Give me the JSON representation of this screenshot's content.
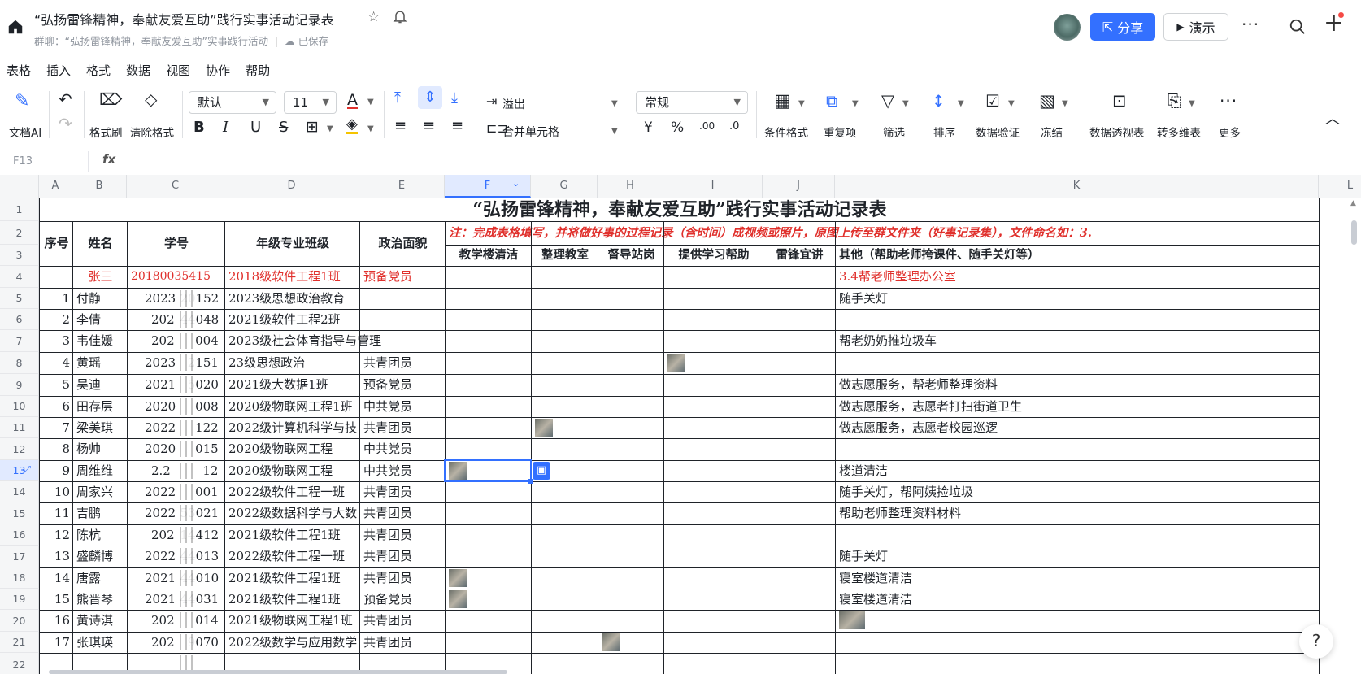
{
  "titlebar": {
    "title": "“弘扬雷锋精神，奉献友爱互助”践行实事活动记录表",
    "subtitle_group": "群聊：“弘扬雷锋精神，奉献友爱互助”实事践行活动",
    "saved_status": "已保存",
    "share_label": "分享",
    "present_label": "演示"
  },
  "menu": [
    "表格",
    "插入",
    "格式",
    "数据",
    "视图",
    "协作",
    "帮助"
  ],
  "toolbar": {
    "doc_ai": "文档AI",
    "format_painter": "格式刷",
    "clear_format": "清除格式",
    "font_name": "默认",
    "font_size": "11",
    "overflow": "溢出",
    "merge_cells": "合并单元格",
    "number_format": "常规",
    "conditional_format": "条件格式",
    "duplicates": "重复项",
    "filter": "筛选",
    "sort": "排序",
    "data_validation": "数据验证",
    "freeze": "冻结",
    "pivot_table": "数据透视表",
    "multi_dim": "转多维表",
    "more": "更多"
  },
  "formula_bar": {
    "cell_ref": "F13",
    "fx": "fx"
  },
  "columns": [
    "A",
    "B",
    "C",
    "D",
    "E",
    "F",
    "G",
    "H",
    "I",
    "J",
    "K",
    "L"
  ],
  "rows": [
    "1",
    "2",
    "3",
    "4",
    "5",
    "6",
    "7",
    "8",
    "9",
    "10",
    "11",
    "12",
    "13",
    "14",
    "15",
    "16",
    "17",
    "18",
    "19",
    "20",
    "21",
    "22"
  ],
  "sheet": {
    "title": "“弘扬雷锋精神，奉献友爱互助”践行实事活动记录表",
    "note": "注：完成表格填写，并将做好事的过程记录（含时间）成视频或照片，原图上传至群文件夹（好事记录集），文件命名如：3.",
    "headers": {
      "seq": "序号",
      "name": "姓名",
      "student_id": "学号",
      "class": "年级专业班级",
      "politics": "政治面貌",
      "f": "教学楼清洁",
      "g": "整理教室",
      "h": "督导站岗",
      "i": "提供学习帮助",
      "j": "雷锋宜讲",
      "k": "其他（帮助老师挎课件、随手关灯等）"
    },
    "example": {
      "name": "张三",
      "student_id": "20180035415",
      "class": "2018级软件工程1班",
      "politics": "预备党员",
      "other": "3.4帮老师整理办公室"
    },
    "records": [
      {
        "seq": "1",
        "name": "付静",
        "id_a": "2023",
        "id_b": "20152",
        "class": "2023级思想政治教育",
        "politics": "",
        "other": "随手关灯"
      },
      {
        "seq": "2",
        "name": "李倩",
        "id_a": "202",
        "id_b": "44048",
        "class": "2021级软件工程2班",
        "politics": "",
        "other": ""
      },
      {
        "seq": "3",
        "name": "韦佳媛",
        "id_a": "202",
        "id_b": "004",
        "class": "2023级社会体育指导与管理",
        "politics": "",
        "other": "帮老奶奶推垃圾车"
      },
      {
        "seq": "4",
        "name": "黄瑶",
        "id_a": "2023",
        "id_b": "2151",
        "class": "23级思想政治",
        "politics": "共青团员",
        "other": ""
      },
      {
        "seq": "5",
        "name": "吴迪",
        "id_a": "2021",
        "id_b": "5020",
        "class": "2021级大数据1班",
        "politics": "预备党员",
        "other": "做志愿服务，帮老师整理资料"
      },
      {
        "seq": "6",
        "name": "田存层",
        "id_a": "2020",
        "id_b": "008",
        "class": "2020级物联网工程1班",
        "politics": "中共党员",
        "other": "做志愿服务，志愿者打扫街道卫生"
      },
      {
        "seq": "7",
        "name": "梁美琪",
        "id_a": "2022",
        "id_b": "122",
        "class": "2022级计算机科学与技",
        "politics": "共青团员",
        "other": "做志愿服务，志愿者校园巡逻"
      },
      {
        "seq": "8",
        "name": "杨帅",
        "id_a": "2020",
        "id_b": "015",
        "class": "2020级物联网工程",
        "politics": "中共党员",
        "other": ""
      },
      {
        "seq": "9",
        "name": "周维维",
        "id_a": "2.2",
        "id_b": "12",
        "class": "2020级物联网工程",
        "politics": "中共党员",
        "other": "楼道清洁"
      },
      {
        "seq": "10",
        "name": "周家兴",
        "id_a": "2022",
        "id_b": "001",
        "class": "2022级软件工程一班",
        "politics": "共青团员",
        "other": "随手关灯，帮阿姨捡垃圾"
      },
      {
        "seq": "11",
        "name": "吉鹏",
        "id_a": "2022",
        "id_b": "53021",
        "class": "2022级数据科学与大数",
        "politics": "共青团员",
        "other": "帮助老师整理资料材料"
      },
      {
        "seq": "12",
        "name": "陈杭",
        "id_a": "202",
        "id_b": "14412",
        "class": "2021级软件工程1班",
        "politics": "共青团员",
        "other": ""
      },
      {
        "seq": "13",
        "name": "盛麟博",
        "id_a": "2022",
        "id_b": "44013",
        "class": "2022级软件工程一班",
        "politics": "共青团员",
        "other": "随手关灯"
      },
      {
        "seq": "14",
        "name": "唐露",
        "id_a": "2021",
        "id_b": "44010",
        "class": "2021级软件工程1班",
        "politics": "共青团员",
        "other": "寝室楼道清洁"
      },
      {
        "seq": "15",
        "name": "熊晋琴",
        "id_a": "2021",
        "id_b": "44031",
        "class": "2021级软件工程1班",
        "politics": "预备党员",
        "other": "寝室楼道清洁"
      },
      {
        "seq": "16",
        "name": "黄诗淇",
        "id_a": "202",
        "id_b": "014",
        "class": "2021级物联网工程1班",
        "politics": "共青团员",
        "other": ""
      },
      {
        "seq": "17",
        "name": "张琪瑛",
        "id_a": "202",
        "id_b": "9070",
        "class": "2022级数学与应用数学",
        "politics": "共青团员",
        "other": ""
      }
    ]
  },
  "colors": {
    "accent": "#3370ff",
    "example_red": "#e0302c",
    "grid_line": "#1f2329"
  }
}
